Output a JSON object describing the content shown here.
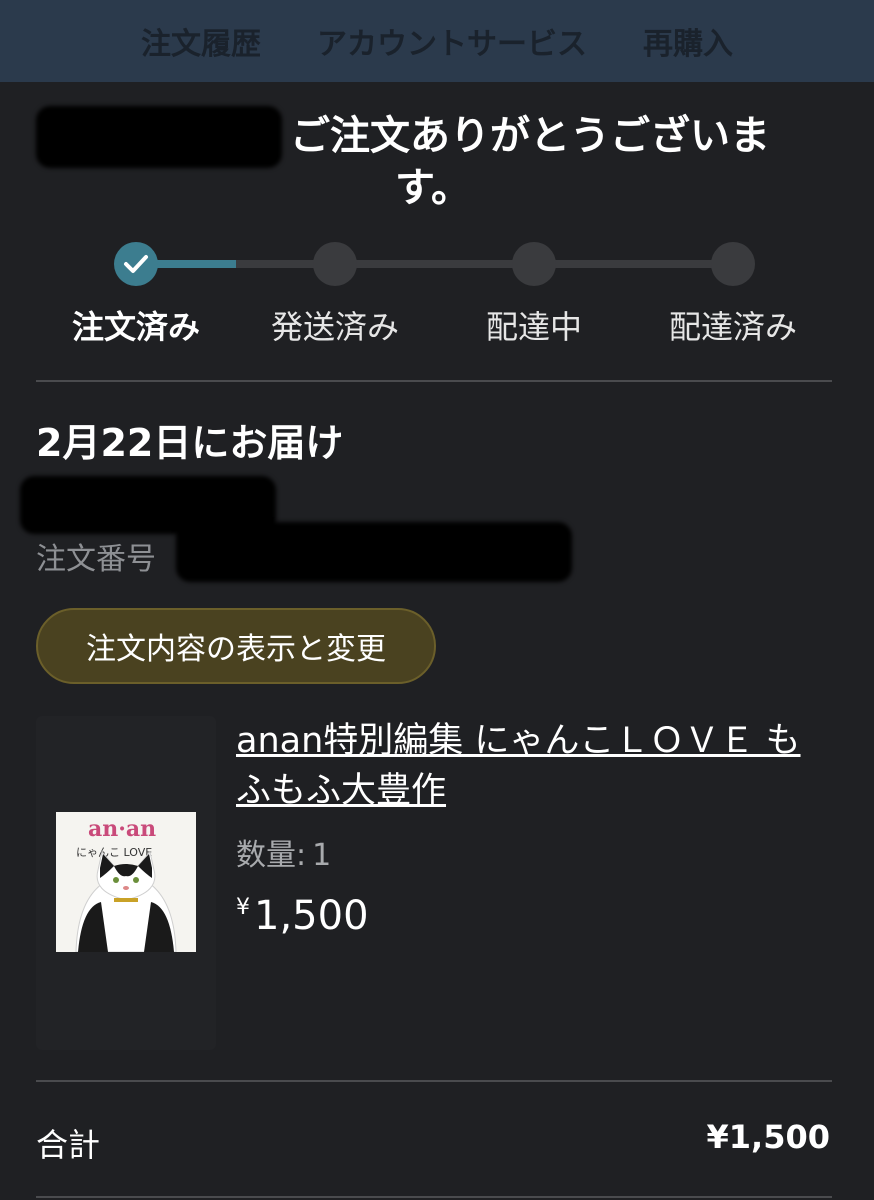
{
  "nav": {
    "items": [
      "注文履歴",
      "アカウントサービス",
      "再購入"
    ]
  },
  "header": {
    "thanks_line1": "ご注文ありがとうございま",
    "thanks_line2": "す。"
  },
  "progress": {
    "steps": [
      "注文済み",
      "発送済み",
      "配達中",
      "配達済み"
    ],
    "current_step": 0
  },
  "delivery": {
    "text": "2月22日にお届け",
    "order_number_label": "注文番号"
  },
  "manage_button": "注文内容の表示と変更",
  "item": {
    "title": "anan特別編集 にゃんこＬＯＶＥ もふもふ大豊作",
    "qty_label": "数量:",
    "qty_value": "1",
    "price_symbol": "¥",
    "price": "1,500",
    "cover": {
      "magazine": "an·an",
      "subtitle": "にゃんこ LOVE"
    }
  },
  "total": {
    "label": "合計",
    "value": "¥1,500"
  },
  "colors": {
    "background": "#1f2023",
    "nav_bg": "#2b3a4c",
    "accent_teal": "#3c7d8f",
    "button_bg": "#4a4220"
  }
}
